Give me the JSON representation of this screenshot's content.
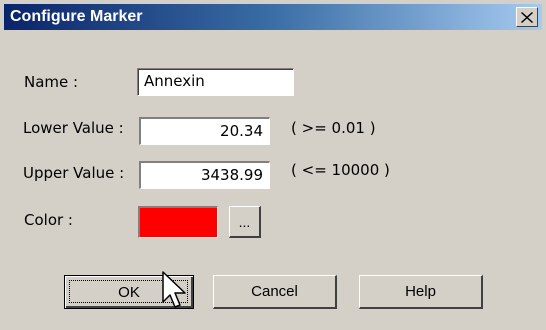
{
  "window": {
    "title": "Configure Marker"
  },
  "fields": {
    "name": {
      "label": "Name :",
      "value": "Annexin"
    },
    "lower": {
      "label": "Lower Value :",
      "value": "20.34",
      "hint": "( >= 0.01 )"
    },
    "upper": {
      "label": "Upper Value :",
      "value": "3438.99",
      "hint": "( <= 10000 )"
    },
    "color": {
      "label": "Color :",
      "swatch": "#ff0000",
      "browse_label": "..."
    }
  },
  "buttons": {
    "ok": "OK",
    "cancel": "Cancel",
    "help": "Help"
  },
  "icons": {
    "close": "close-icon",
    "cursor": "mouse-pointer-icon"
  }
}
